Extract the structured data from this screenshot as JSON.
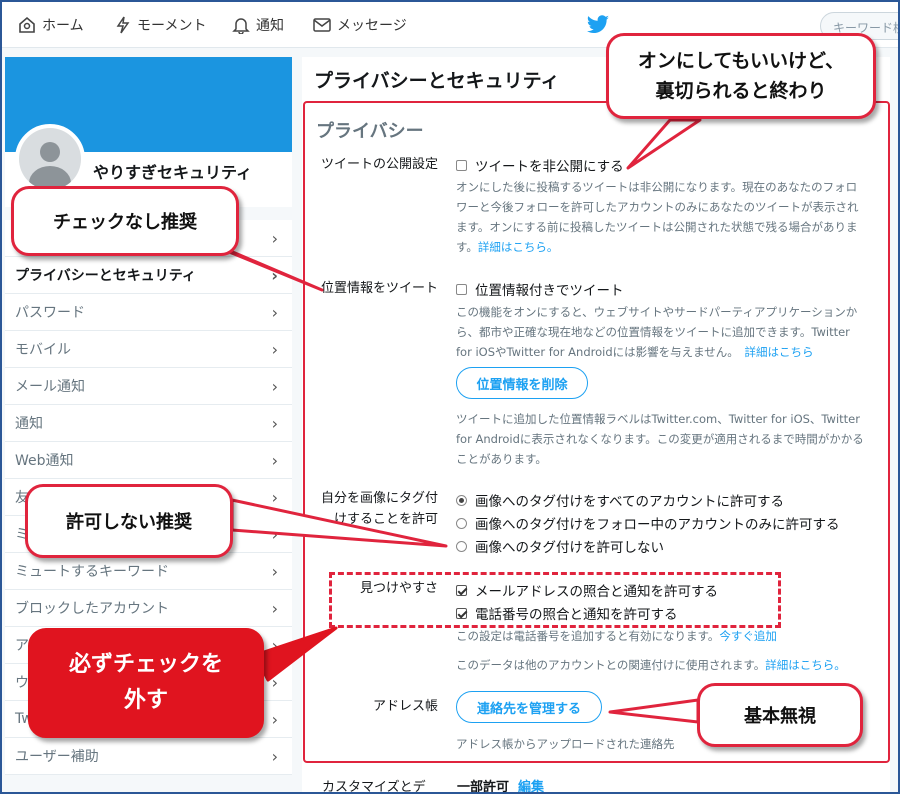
{
  "nav": {
    "home": "ホーム",
    "moment": "モーメント",
    "notifications": "通知",
    "messages": "メッセージ",
    "search_placeholder": "キーワード検"
  },
  "profile": {
    "name": "やりすぎセキュリティ"
  },
  "menu": [
    {
      "label": ""
    },
    {
      "label": "プライバシーとセキュリティ",
      "active": true
    },
    {
      "label": "パスワード"
    },
    {
      "label": "モバイル"
    },
    {
      "label": "メール通知"
    },
    {
      "label": "通知"
    },
    {
      "label": "Web通知"
    },
    {
      "label": "友"
    },
    {
      "label": "ミ"
    },
    {
      "label": "ミュートするキーワード"
    },
    {
      "label": "ブロックしたアカウント"
    },
    {
      "label": "ア"
    },
    {
      "label": "ウ"
    },
    {
      "label": "Tw"
    },
    {
      "label": "ユーザー補助"
    }
  ],
  "page_title": "プライバシーとセキュリティ",
  "privacy": {
    "title": "プライバシー",
    "tweet_privacy": {
      "label": "ツイートの公開設定",
      "checkbox": "ツイートを非公開にする",
      "checked": false,
      "desc": "オンにした後に投稿するツイートは非公開になります。現在のあなたのフォロワーと今後フォローを許可したアカウントのみにあなたのツイートが表示されます。オンにする前に投稿したツイートは公開された状態で残る場合があります。",
      "link": "詳細はこちら。"
    },
    "location": {
      "label": "位置情報をツイート",
      "checkbox": "位置情報付きでツイート",
      "checked": false,
      "desc": "この機能をオンにすると、ウェブサイトやサードパーティアプリケーションから、都市や正確な現在地などの位置情報をツイートに追加できます。Twitter for iOSやTwitter for Androidには影響を与えません。",
      "link": "詳細はこちら",
      "button": "位置情報を削除",
      "desc2": "ツイートに追加した位置情報ラベルはTwitter.com、Twitter for iOS、Twitter for Androidに表示されなくなります。この変更が適用されるまで時間がかかることがあります。"
    },
    "photo_tagging": {
      "label": "自分を画像にタグ付けすることを許可",
      "options": [
        "画像へのタグ付けをすべてのアカウントに許可する",
        "画像へのタグ付けをフォロー中のアカウントのみに許可する",
        "画像へのタグ付けを許可しない"
      ],
      "selected": 0
    },
    "discoverability": {
      "label": "見つけやすさ",
      "options": [
        {
          "label": "メールアドレスの照合と通知を許可する",
          "checked": true
        },
        {
          "label": "電話番号の照合と通知を許可する",
          "checked": true
        }
      ],
      "note1": "この設定は電話番号を追加すると有効になります。",
      "note1_link": "今すぐ追加",
      "note2": "このデータは他のアカウントとの関連付けに使用されます。",
      "note2_link": "詳細はこちら。"
    },
    "address_book": {
      "label": "アドレス帳",
      "button": "連絡先を管理する",
      "desc": "アドレス帳からアップロードされた連絡先"
    },
    "personalize": {
      "label": "カスタマイズとデ",
      "value": "一部許可",
      "edit": "編集"
    }
  },
  "callouts": {
    "top": "オンにしてもいいけど、\n裏切られると終わり",
    "no_check": "チェックなし推奨",
    "not_allow": "許可しない推奨",
    "must_uncheck": "必ずチェックを\n外す",
    "ignore": "基本無視"
  },
  "colors": {
    "accent": "#1da1f2",
    "callout_red": "#e0141f",
    "banner": "#1b95e0"
  }
}
